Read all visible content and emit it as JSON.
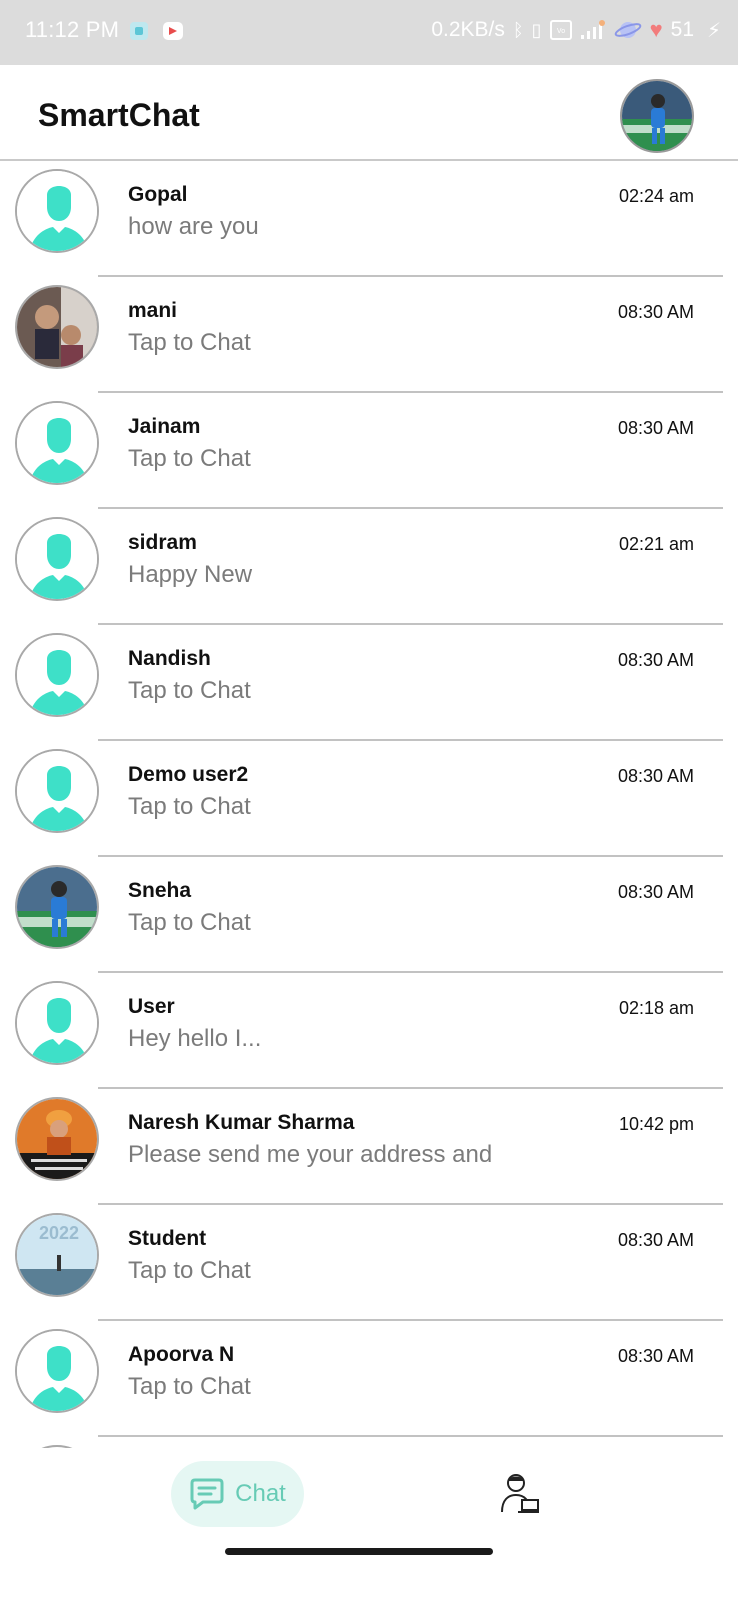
{
  "status_bar": {
    "time": "11:12 PM",
    "net_speed": "0.2KB/s",
    "battery": "51",
    "icons": [
      "bluetooth-icon",
      "vibrate-icon",
      "volte-icon",
      "signal-icon",
      "planet-icon",
      "heart-icon",
      "charging-icon"
    ]
  },
  "app_bar": {
    "title": "SmartChat",
    "profile_icon": "profile-avatar"
  },
  "chats": [
    {
      "name": "Gopal",
      "message": "how are you",
      "time": "02:24 am",
      "avatar": "default"
    },
    {
      "name": "mani",
      "message": "Tap to Chat",
      "time": "08:30 AM",
      "avatar": "photo-family"
    },
    {
      "name": "Jainam",
      "message": "Tap to Chat",
      "time": "08:30 AM",
      "avatar": "default"
    },
    {
      "name": "sidram",
      "message": "Happy New",
      "time": "02:21 am",
      "avatar": "default"
    },
    {
      "name": "Nandish",
      "message": "Tap to Chat",
      "time": "08:30 AM",
      "avatar": "default"
    },
    {
      "name": "Demo user2",
      "message": "Tap to Chat",
      "time": "08:30 AM",
      "avatar": "default"
    },
    {
      "name": "Sneha",
      "message": "Tap to Chat",
      "time": "08:30 AM",
      "avatar": "photo-cricket"
    },
    {
      "name": "User",
      "message": "Hey hello I...",
      "time": "02:18 am",
      "avatar": "default"
    },
    {
      "name": "Naresh Kumar Sharma",
      "message": "Please send me your address and",
      "time": "10:42 pm",
      "avatar": "photo-saint"
    },
    {
      "name": "Student",
      "message": "Tap to Chat",
      "time": "08:30 AM",
      "avatar": "photo-2022"
    },
    {
      "name": "Apoorva N",
      "message": "Tap to Chat",
      "time": "08:30 AM",
      "avatar": "default"
    }
  ],
  "bottom_nav": {
    "chat_label": "Chat",
    "chat_icon": "chat-bubble-icon",
    "profile_icon": "user-laptop-icon"
  },
  "colors": {
    "accent": "#3ee0c8",
    "status_bar_bg": "#dcdcdc",
    "nav_active_bg": "#e5f7f3",
    "nav_active_text": "#67cbb5"
  }
}
